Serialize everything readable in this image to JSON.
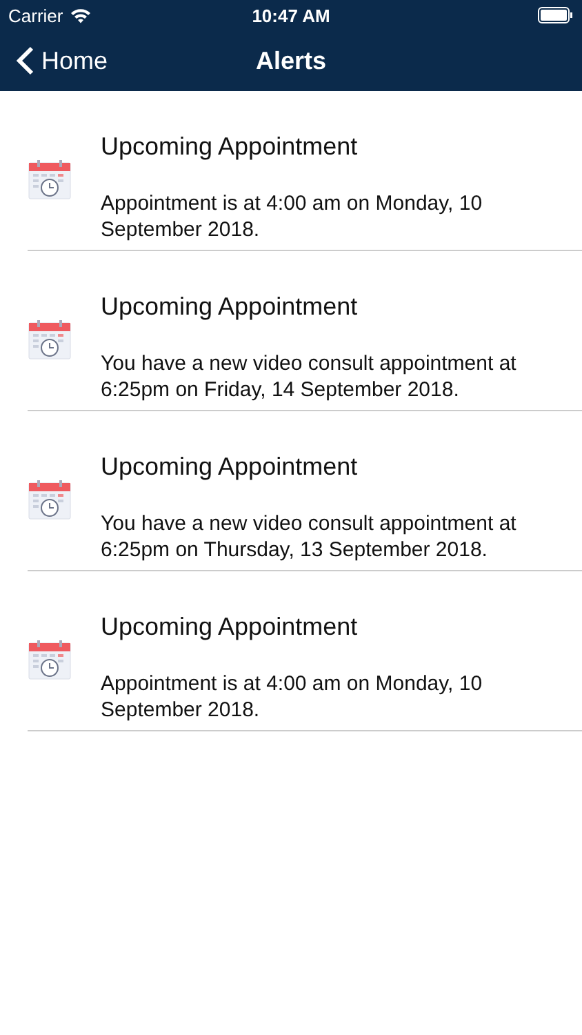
{
  "status_bar": {
    "carrier": "Carrier",
    "time": "10:47 AM"
  },
  "nav": {
    "back": "Home",
    "title": "Alerts"
  },
  "alerts": [
    {
      "title": "Upcoming Appointment",
      "body": "Appointment is at 4:00 am on Monday, 10 September 2018."
    },
    {
      "title": "Upcoming Appointment",
      "body": "You have a new video consult appointment at 6:25pm on Friday, 14 September 2018."
    },
    {
      "title": "Upcoming Appointment",
      "body": "You have a new video consult appointment at 6:25pm on Thursday, 13 September 2018."
    },
    {
      "title": "Upcoming Appointment",
      "body": "Appointment is at 4:00 am on Monday, 10 September 2018."
    }
  ]
}
